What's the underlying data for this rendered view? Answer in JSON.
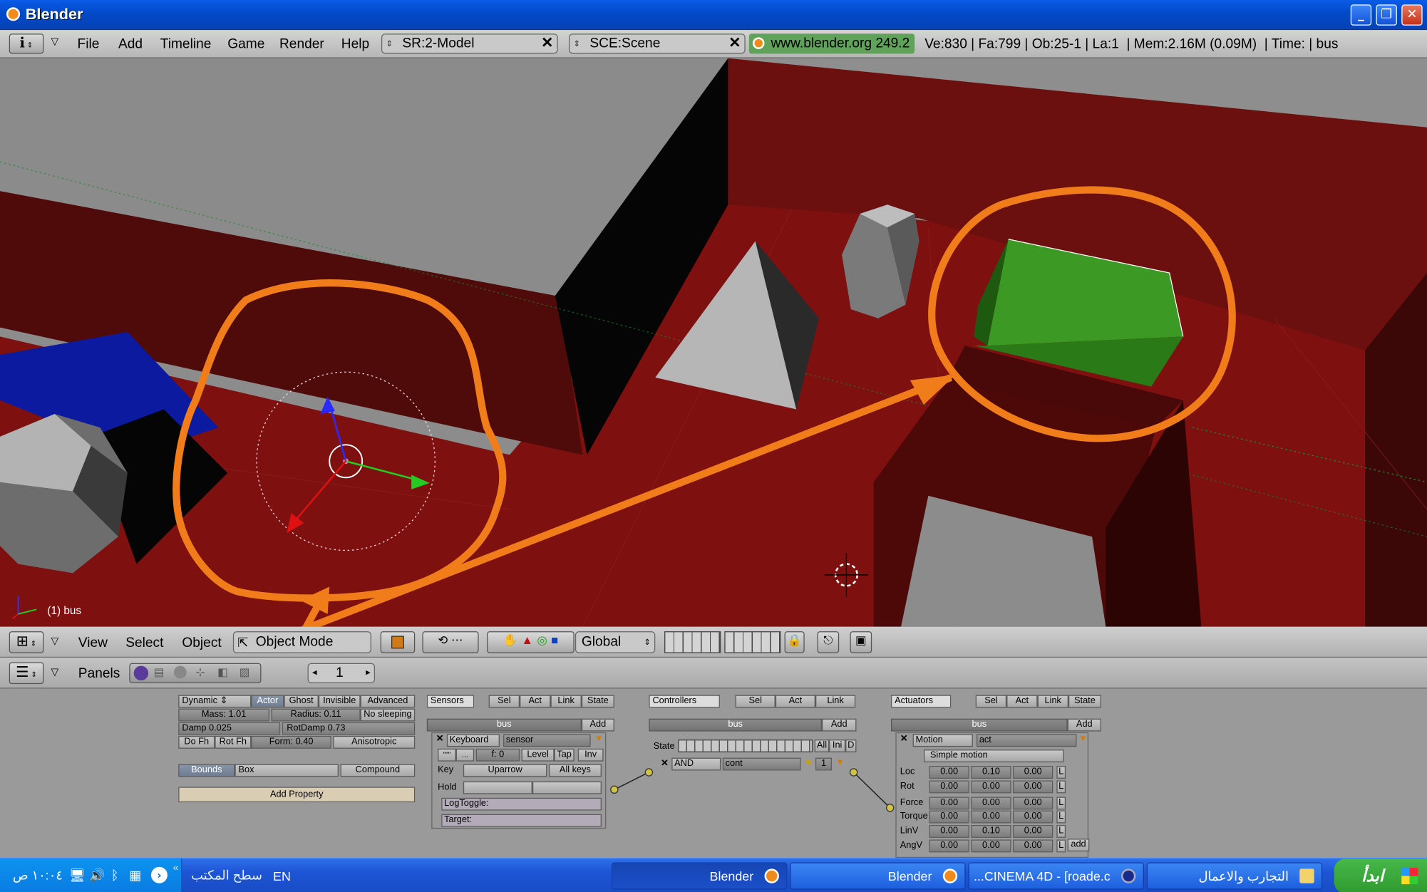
{
  "window": {
    "title": "Blender"
  },
  "info": {
    "menus": [
      "File",
      "Add",
      "Timeline",
      "Game",
      "Render",
      "Help"
    ],
    "screen": "SR:2-Model",
    "scene": "SCE:Scene",
    "url": "www.blender.org 249.2",
    "stats": "Ve:830 | Fa:799 | Ob:25-1 | La:1  | Mem:2.16M (0.09M)  | Time: | bus"
  },
  "viewport": {
    "object_label": "(1) bus"
  },
  "view3d_header": {
    "menus": [
      "View",
      "Select",
      "Object"
    ],
    "mode": "Object Mode",
    "orientation": "Global"
  },
  "buttons_header": {
    "menu": "Panels",
    "frame": "1"
  },
  "physics": {
    "type": "Dynamic",
    "tabs": [
      "Actor",
      "Ghost",
      "Invisible",
      "Advanced"
    ],
    "mass": "Mass: 1.01",
    "radius": "Radius: 0.11",
    "no_sleeping": "No sleeping",
    "damp": "Damp 0.025",
    "rotdamp": "RotDamp 0.73",
    "do_fh": "Do Fh",
    "rot_fh": "Rot Fh",
    "form": "Form: 0.40",
    "anisotropic": "Anisotropic",
    "bounds": "Bounds",
    "bounds_type": "Box",
    "compound": "Compound",
    "add_property": "Add Property"
  },
  "sensors": {
    "title": "Sensors",
    "filters": [
      "Sel",
      "Act",
      "Link",
      "State"
    ],
    "object": "bus",
    "add": "Add",
    "type": "Keyboard",
    "name": "sensor",
    "freq": "f: 0",
    "level": "Level",
    "tap": "Tap",
    "inv": "Inv",
    "key_label": "Key",
    "key_value": "Uparrow",
    "all_keys": "All keys",
    "hold_label": "Hold",
    "logtoggle": "LogToggle:",
    "target": "Target:"
  },
  "controllers": {
    "title": "Controllers",
    "filters": [
      "Sel",
      "Act",
      "Link"
    ],
    "object": "bus",
    "add": "Add",
    "state_label": "State",
    "state_buttons": [
      "All",
      "Ini",
      "D"
    ],
    "type": "AND",
    "name": "cont",
    "value": "1"
  },
  "actuators": {
    "title": "Actuators",
    "filters": [
      "Sel",
      "Act",
      "Link",
      "State"
    ],
    "object": "bus",
    "add": "Add",
    "type": "Motion",
    "name": "act",
    "mode": "Simple motion",
    "rows": [
      {
        "label": "Loc",
        "values": [
          "0.00",
          "0.10",
          "0.00"
        ]
      },
      {
        "label": "Rot",
        "values": [
          "0.00",
          "0.00",
          "0.00"
        ]
      },
      {
        "label": "Force",
        "values": [
          "0.00",
          "0.00",
          "0.00"
        ]
      },
      {
        "label": "Torque",
        "values": [
          "0.00",
          "0.00",
          "0.00"
        ]
      },
      {
        "label": "LinV",
        "values": [
          "0.00",
          "0.10",
          "0.00"
        ]
      },
      {
        "label": "AngV",
        "values": [
          "0.00",
          "0.00",
          "0.00"
        ]
      }
    ],
    "local": "L",
    "add_btn": "add"
  },
  "taskbar": {
    "start": "ابدأ",
    "buttons": [
      "Blender",
      "Blender",
      "...CINEMA 4D - [roade.c",
      "التجارب والاعمال"
    ],
    "clock": "١٠:٠٤ ص",
    "desktop": "سطح المكتب",
    "lang": "EN"
  },
  "colors": {
    "floor": "#7e1010",
    "wall": "#5a0c0c",
    "green_box": "#2f8a1f",
    "annotation": "#f07d1a",
    "blue_block": "#0c1aa0"
  }
}
